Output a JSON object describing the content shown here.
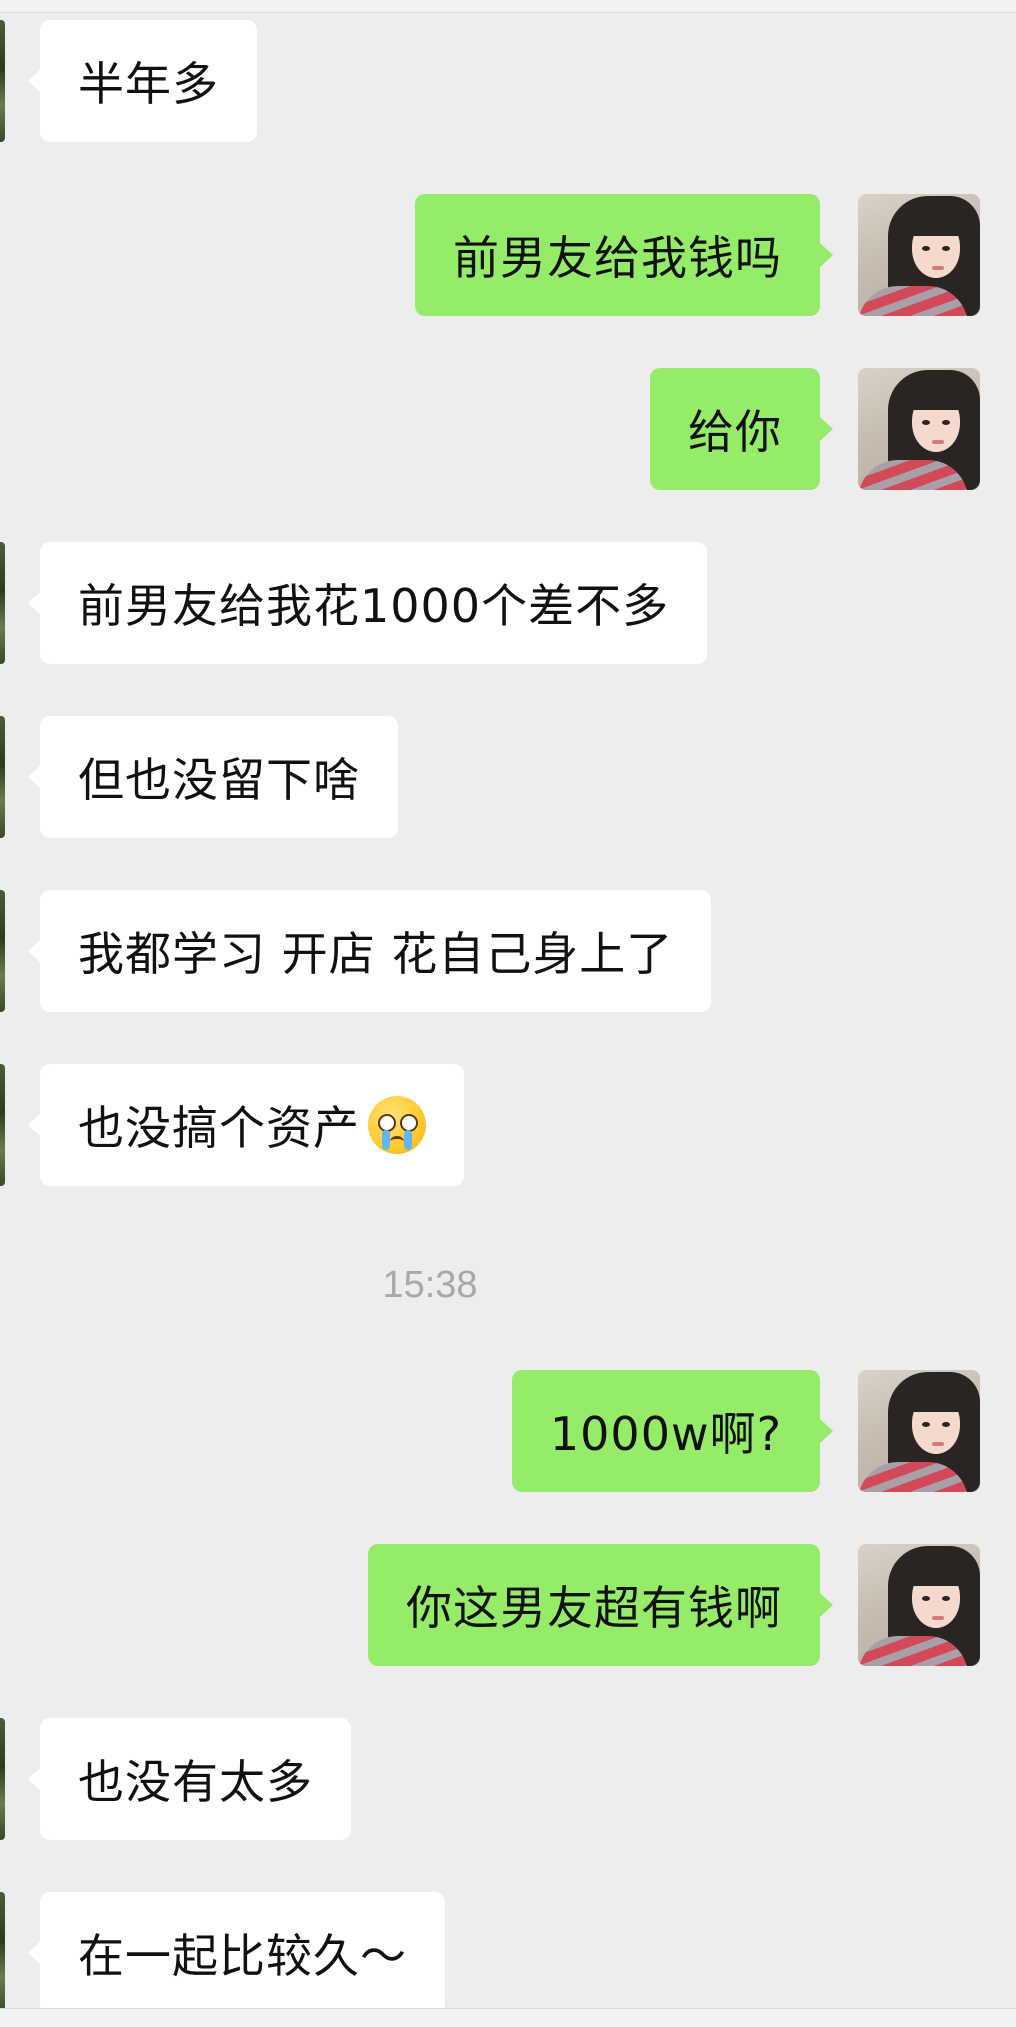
{
  "chat": {
    "messages": [
      {
        "side": "left",
        "text": "半年多"
      },
      {
        "side": "right",
        "text": "前男友给我钱吗"
      },
      {
        "side": "right",
        "text": "给你"
      },
      {
        "side": "left",
        "text": "前男友给我花1000个差不多"
      },
      {
        "side": "left",
        "text": "但也没留下啥"
      },
      {
        "side": "left",
        "text": "我都学习 开店 花自己身上了"
      },
      {
        "side": "left",
        "text": "也没搞个资产",
        "emoji": "crying-face-emoji"
      },
      {
        "side": "right",
        "text": "1000w啊?"
      },
      {
        "side": "right",
        "text": "你这男友超有钱啊"
      },
      {
        "side": "left",
        "text": "也没有太多"
      },
      {
        "side": "left",
        "text": "在一起比较久～"
      }
    ],
    "timestamp": "15:38"
  },
  "colors": {
    "background": "#ededed",
    "incoming_bubble": "#ffffff",
    "outgoing_bubble": "#95ec69",
    "timestamp_text": "#a8a8a8"
  }
}
